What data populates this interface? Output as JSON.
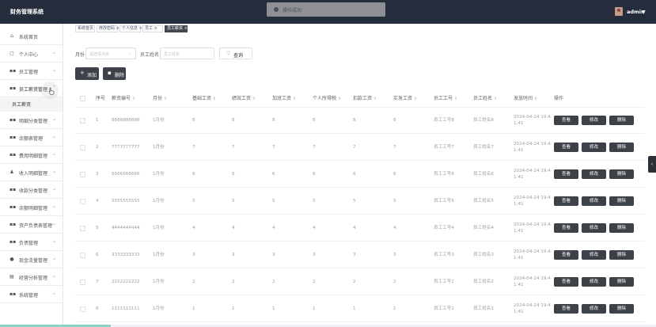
{
  "app": {
    "title": "财务管理系统",
    "user": "admin",
    "toast": "操作成功"
  },
  "sidebar": {
    "items": [
      {
        "label": "系统首页",
        "icon": "home-icon"
      },
      {
        "label": "个人中心",
        "icon": "user-icon"
      },
      {
        "label": "员工管理",
        "icon": "grid-icon"
      },
      {
        "label": "员工薪资管理",
        "icon": "grid-icon"
      },
      {
        "label": "明细分类管理",
        "icon": "grid-icon"
      },
      {
        "label": "余额表管理",
        "icon": "grid-icon"
      },
      {
        "label": "费用明细管理",
        "icon": "grid-icon"
      },
      {
        "label": "收入明细管理",
        "icon": "person-icon"
      },
      {
        "label": "收款分类管理",
        "icon": "grid-icon"
      },
      {
        "label": "余额明细管理",
        "icon": "grid-icon"
      },
      {
        "label": "资产负债表管理",
        "icon": "grid-icon"
      },
      {
        "label": "负债管理",
        "icon": "grid-icon"
      },
      {
        "label": "现金流量管理",
        "icon": "chat-icon"
      },
      {
        "label": "经营分析管理",
        "icon": "chart-icon"
      },
      {
        "label": "系统管理",
        "icon": "grid-icon"
      }
    ],
    "sub_item": "员工薪资"
  },
  "tabs": [
    "系统首页",
    "修改密码",
    "个人信息",
    "员工",
    "员工薪资"
  ],
  "search": {
    "month_label": "月份",
    "month_placeholder": "请选择月份",
    "name_label": "员工姓名",
    "name_placeholder": "员工姓名",
    "query_label": "查询"
  },
  "actions": {
    "add_label": "添加",
    "delete_label": "删除"
  },
  "table": {
    "headers": [
      "序号",
      "薪资编号",
      "月份",
      "基础工资",
      "绩效工资",
      "加班工资",
      "个人所得税",
      "扣款工资",
      "实发工资",
      "员工工号",
      "员工姓名",
      "发放时间",
      "操作"
    ],
    "rows": [
      {
        "idx": "1",
        "code": "8888888888",
        "month": "1月份",
        "base": "8",
        "perf": "8",
        "ot": "8",
        "tax": "8",
        "deduct": "8",
        "net": "8",
        "emp_no": "员工工号8",
        "emp_name": "员工姓名8",
        "time1": "2024-04-24 19:4",
        "time2": "1:41"
      },
      {
        "idx": "2",
        "code": "7777777777",
        "month": "1月份",
        "base": "7",
        "perf": "7",
        "ot": "7",
        "tax": "7",
        "deduct": "7",
        "net": "7",
        "emp_no": "员工工号7",
        "emp_name": "员工姓名7",
        "time1": "2024-04-24 19:4",
        "time2": "1:41"
      },
      {
        "idx": "3",
        "code": "6666666666",
        "month": "1月份",
        "base": "6",
        "perf": "6",
        "ot": "6",
        "tax": "6",
        "deduct": "6",
        "net": "6",
        "emp_no": "员工工号6",
        "emp_name": "员工姓名6",
        "time1": "2024-04-24 19:4",
        "time2": "1:41"
      },
      {
        "idx": "4",
        "code": "5555555555",
        "month": "1月份",
        "base": "5",
        "perf": "5",
        "ot": "5",
        "tax": "5",
        "deduct": "5",
        "net": "5",
        "emp_no": "员工工号5",
        "emp_name": "员工姓名5",
        "time1": "2024-04-24 19:4",
        "time2": "1:41"
      },
      {
        "idx": "5",
        "code": "4444444444",
        "month": "1月份",
        "base": "4",
        "perf": "4",
        "ot": "4",
        "tax": "4",
        "deduct": "4",
        "net": "4",
        "emp_no": "员工工号4",
        "emp_name": "员工姓名4",
        "time1": "2024-04-24 19:4",
        "time2": "1:41"
      },
      {
        "idx": "6",
        "code": "3333333333",
        "month": "1月份",
        "base": "3",
        "perf": "3",
        "ot": "3",
        "tax": "3",
        "deduct": "3",
        "net": "3",
        "emp_no": "员工工号3",
        "emp_name": "员工姓名3",
        "time1": "2024-04-24 19:4",
        "time2": "1:41"
      },
      {
        "idx": "7",
        "code": "2222222222",
        "month": "1月份",
        "base": "2",
        "perf": "2",
        "ot": "2",
        "tax": "2",
        "deduct": "2",
        "net": "2",
        "emp_no": "员工工号2",
        "emp_name": "员工姓名2",
        "time1": "2024-04-24 19:4",
        "time2": "1:41"
      },
      {
        "idx": "8",
        "code": "1111111111",
        "month": "1月份",
        "base": "1",
        "perf": "1",
        "ot": "1",
        "tax": "1",
        "deduct": "1",
        "net": "1",
        "emp_no": "员工工号1",
        "emp_name": "员工姓名1",
        "time1": "2024-04-24 19:4",
        "time2": "1:41"
      }
    ],
    "row_actions": {
      "view": "查看",
      "edit": "修改",
      "delete": "删除"
    }
  }
}
